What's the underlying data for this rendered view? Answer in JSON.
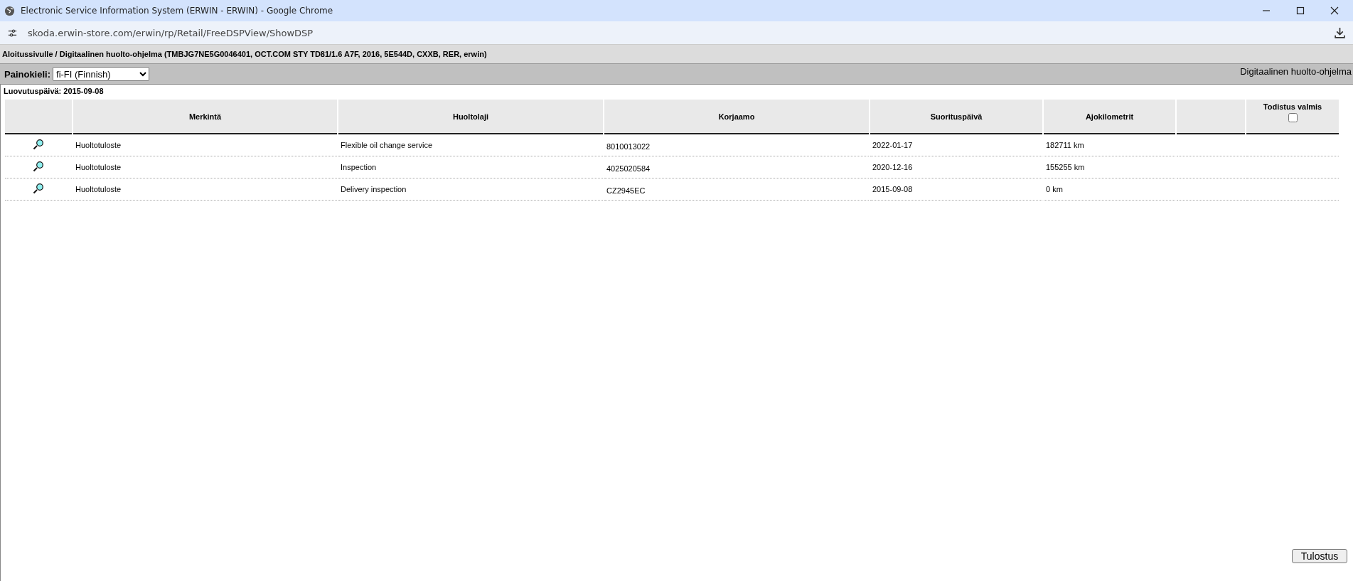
{
  "window": {
    "title": "Electronic Service Information System (ERWIN - ERWIN) - Google Chrome"
  },
  "address_bar": {
    "url": "skoda.erwin-store.com/erwin/rp/Retail/FreeDSPView/ShowDSP"
  },
  "breadcrumb": "Aloitussivulle / Digitaalinen huolto-ohjelma (TMBJG7NE5G0046401, OCT.COM STY TD81/1.6 A7F, 2016, 5E544D, CXXB, RER, erwin)",
  "toolbar": {
    "language_label": "Painokieli:",
    "language_value": "fi-FI (Finnish)",
    "page_title": "Digitaalinen huolto-ohjelma"
  },
  "delivery_date": "Luovutuspäivä: 2015-09-08",
  "table": {
    "columns": [
      "Merkintä",
      "Huoltolaji",
      "Korjaamo",
      "Suorituspäivä",
      "Ajokilometrit"
    ],
    "certificate_column": {
      "label": "Todistus valmis",
      "checked": false
    },
    "rows": [
      {
        "cells": [
          "Huoltotuloste",
          "Flexible oil change service",
          "8010013022",
          "2022-01-17",
          "182711 km"
        ]
      },
      {
        "cells": [
          "Huoltotuloste",
          "Inspection",
          "4025020584",
          "2020-12-16",
          "155255 km"
        ]
      },
      {
        "cells": [
          "Huoltotuloste",
          "Delivery inspection",
          "CZ2945EC",
          "2015-09-08",
          "0 km"
        ]
      }
    ]
  },
  "buttons": [
    "Tulostus"
  ]
}
